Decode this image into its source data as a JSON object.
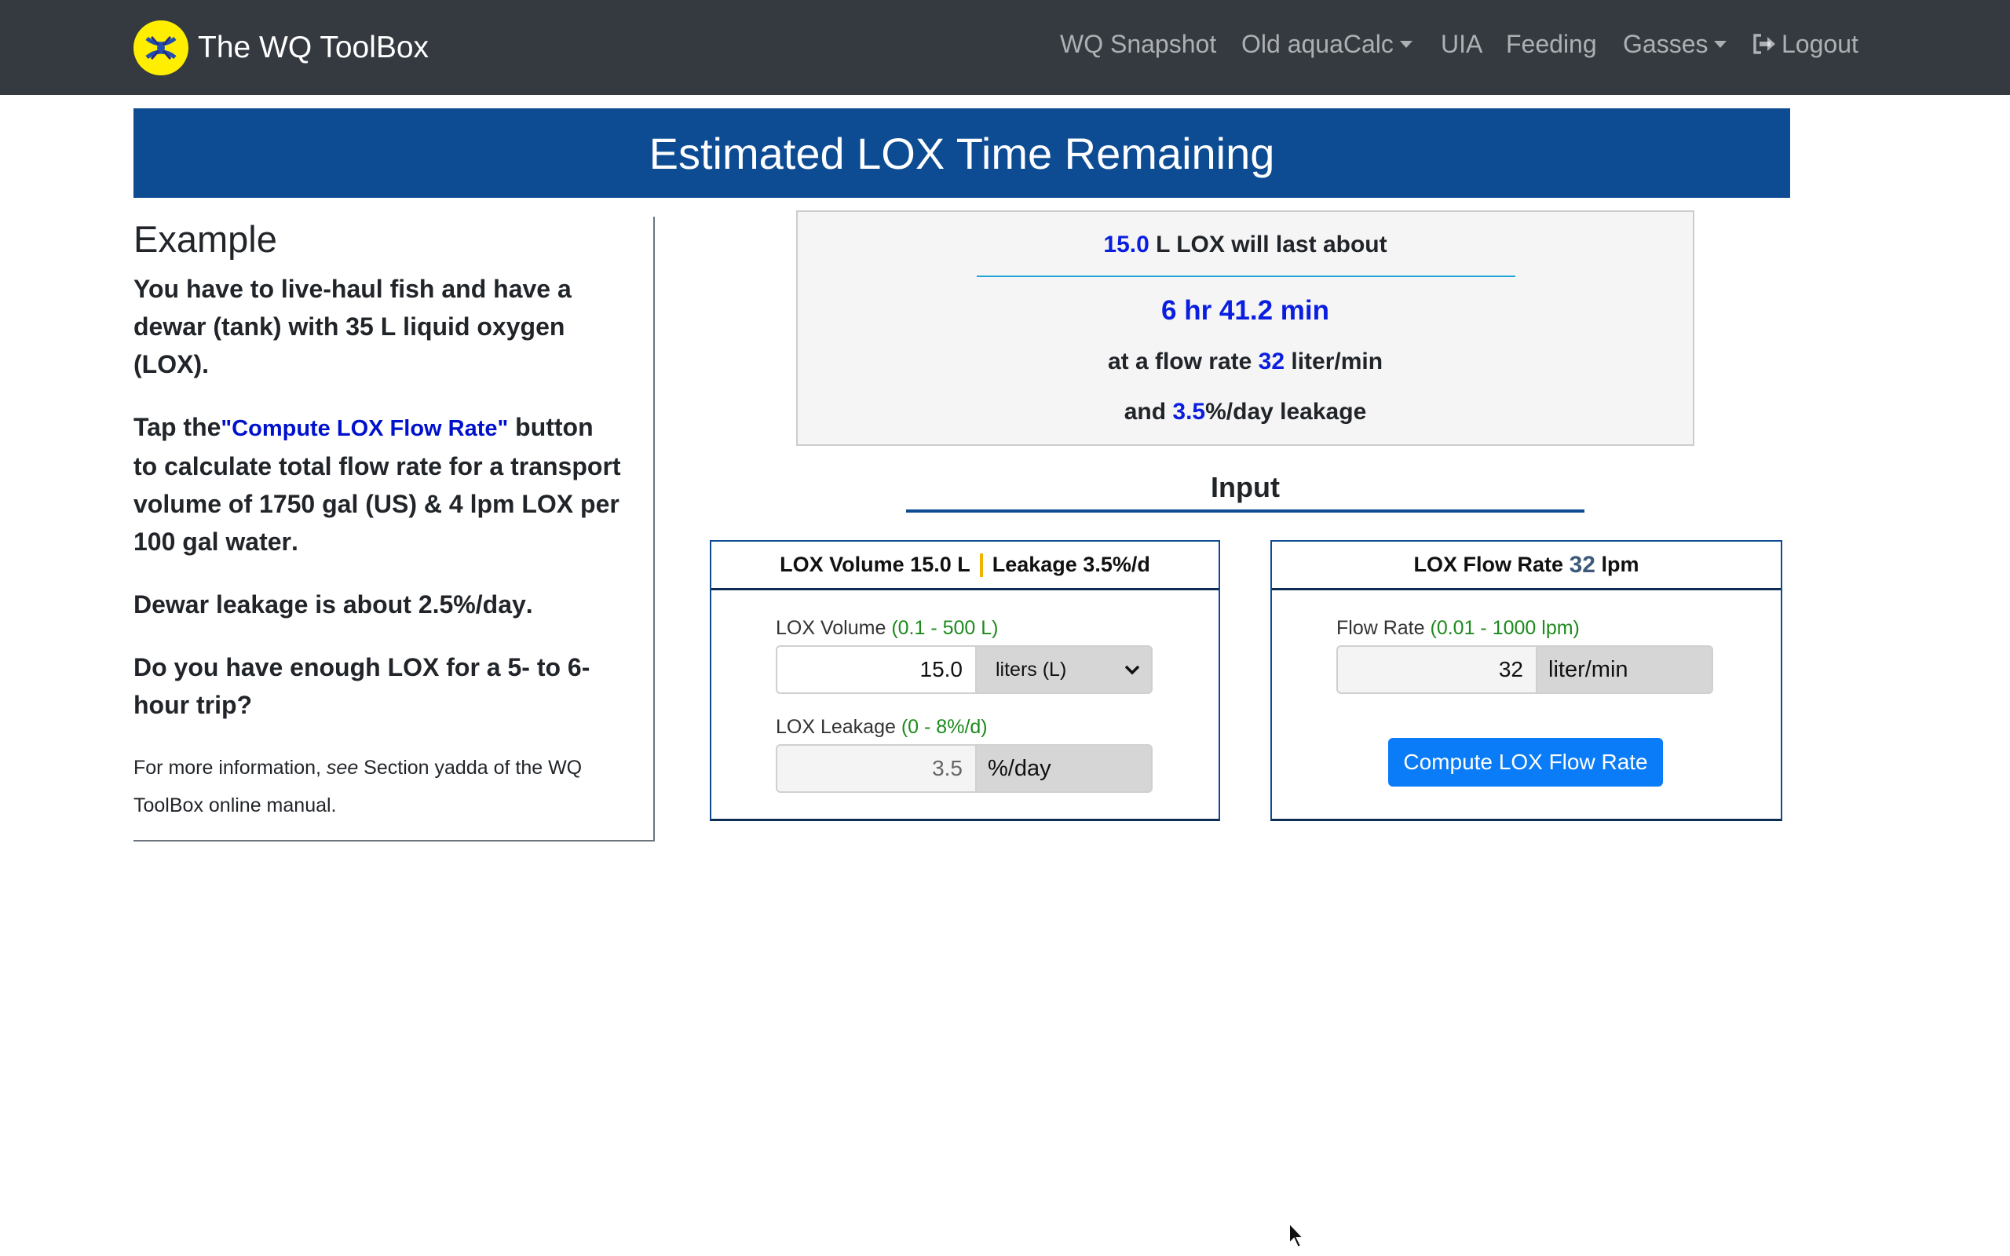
{
  "navbar": {
    "brand": "The WQ ToolBox",
    "items": [
      {
        "label": "WQ Snapshot"
      },
      {
        "label": "Old aquaCalc"
      },
      {
        "label": "UIA"
      },
      {
        "label": "Feeding"
      },
      {
        "label": "Gasses"
      },
      {
        "label": "Logout"
      }
    ]
  },
  "banner": {
    "title": "Estimated LOX Time Remaining"
  },
  "example": {
    "heading": "Example",
    "p1": {
      "a": "You have to live-haul fish and have a dewar (tank) with ",
      "b": "35 L",
      "c": " liquid oxygen (LOX)."
    },
    "p2": {
      "a": "Tap the",
      "link": "\"Compute LOX Flow Rate\"",
      "b": " button to calculate total flow rate for a transport volume of ",
      "c": "1750 gal (US)",
      "d": " & ",
      "e": "4 lpm LOX per 100 gal water",
      "f": "."
    },
    "p3": {
      "a": "Dewar leakage is about ",
      "b": "2.5%/day",
      "c": "."
    },
    "p4": "Do you have enough LOX for a 5- to 6-hour trip?",
    "p5": {
      "a": "For more information, ",
      "em": "see",
      "b": " Section yadda of the WQ ToolBox online manual."
    }
  },
  "result": {
    "volume": "15.0",
    "volume_suffix": " L LOX will last about",
    "time": "6 hr 41.2 min",
    "flow_prefix": "at a flow rate ",
    "flow": "32",
    "flow_suffix": " liter/min",
    "leak_prefix": "and ",
    "leak": "3.5",
    "leak_suffix": "%/day leakage"
  },
  "input": {
    "title": "Input",
    "volume_card": {
      "head_left": "LOX Volume 15.0 L",
      "head_right": "Leakage 3.5%/d",
      "volume_label": "LOX Volume",
      "volume_range": "(0.1 - 500 L)",
      "volume_value": "15.0",
      "volume_unit": "liters (L)",
      "leak_label": "LOX Leakage",
      "leak_range": "(0 - 8%/d)",
      "leak_value": "3.5",
      "leak_unit": "%/day"
    },
    "flow_card": {
      "head_prefix": "LOX Flow Rate ",
      "head_value": "32",
      "head_suffix": " lpm",
      "flow_label": "Flow Rate",
      "flow_range": "(0.01 - 1000 lpm)",
      "flow_value": "32",
      "flow_unit": "liter/min",
      "button": "Compute LOX Flow Rate"
    }
  },
  "colors": {
    "navbar": "#343a40",
    "banner": "#0d4c93",
    "highlight": "#0a1ee0",
    "range": "#1d8a1d",
    "button": "#0a7cf7",
    "logo": "#ffee00"
  }
}
